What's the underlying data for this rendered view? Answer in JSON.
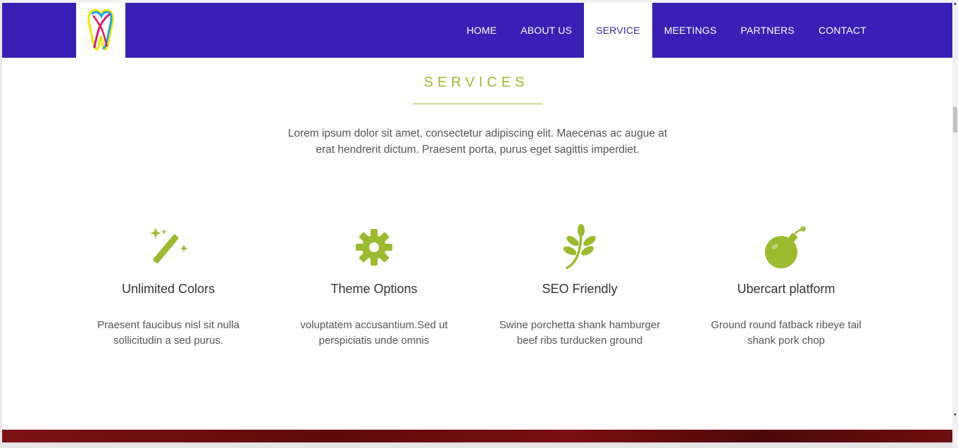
{
  "brand": {
    "logo_icon": "tooth-logo-icon",
    "colors": {
      "nav_bg": "#3a1fb6",
      "accent": "#9bbb2f",
      "footer": "#6d0f10"
    }
  },
  "nav": {
    "items": [
      {
        "label": "HOME"
      },
      {
        "label": "ABOUT US"
      },
      {
        "label": "SERVICE"
      },
      {
        "label": "MEETINGS"
      },
      {
        "label": "PARTNERS"
      },
      {
        "label": "CONTACT"
      }
    ],
    "active": "SERVICE"
  },
  "services": {
    "title": "SERVICES",
    "intro_line1": "Lorem ipsum dolor sit amet, consectetur adipiscing elit. Maecenas ac augue at",
    "intro_line2": "erat hendrerit dictum. Praesent porta, purus eget sagittis imperdiet.",
    "features": [
      {
        "icon": "magic-wand-icon",
        "name": "Unlimited Colors",
        "desc_line1": "Praesent faucibus nisl sit nulla",
        "desc_line2": "sollicitudin a sed purus."
      },
      {
        "icon": "gear-icon",
        "name": "Theme Options",
        "desc_line1": "voluptatem accusantium.Sed ut",
        "desc_line2": "perspiciatis unde omnis"
      },
      {
        "icon": "leaf-icon",
        "name": "SEO Friendly",
        "desc_line1": "Swine porchetta shank hamburger",
        "desc_line2": "beef ribs turducken ground"
      },
      {
        "icon": "bomb-icon",
        "name": "Ubercart platform",
        "desc_line1": "Ground round fatback ribeye tail",
        "desc_line2": "shank pork chop"
      }
    ]
  }
}
